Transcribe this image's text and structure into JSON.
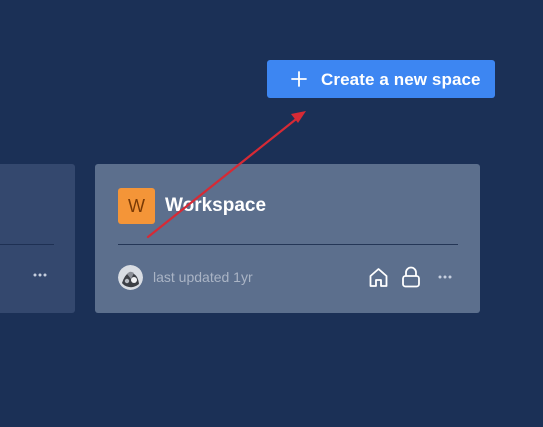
{
  "header": {
    "create_button": {
      "icon": "plus-icon",
      "label": "Create a new space",
      "color": "#3d86f2"
    }
  },
  "spaces": {
    "partial_card": {
      "more_icon": "ellipsis-icon"
    },
    "workspace_card": {
      "icon_letter": "W",
      "icon_color": "#f49538",
      "title": "Workspace",
      "avatar_icon": "user-avatar",
      "updated_text": "last updated 1yr",
      "home_icon": "home-icon",
      "lock_icon": "lock-icon",
      "more_icon": "ellipsis-icon"
    }
  },
  "annotation": {
    "arrow_color": "#d62a35"
  },
  "theme": {
    "background": "#1b3056",
    "card_active": "#5c6f8d",
    "card_inactive": "#34486e"
  }
}
